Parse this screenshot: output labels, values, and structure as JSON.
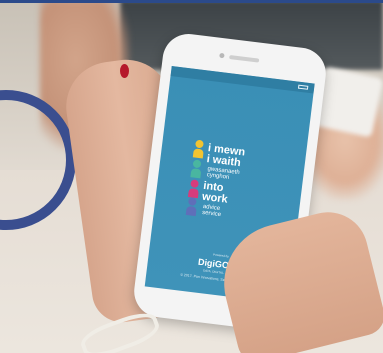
{
  "app_screen": {
    "logo_line1": "i mewn",
    "logo_line2": "i waith",
    "logo_line3": "gwasanaeth",
    "logo_line4": "cynghori",
    "logo_line5": "into",
    "logo_line6": "work",
    "logo_line7": "advice",
    "logo_line8": "service",
    "powered_by": "Powered by",
    "brand": "DigiGOV",
    "brand_tagline": "DATA. DIGITAL. DESIGN",
    "copyright": "© 2017. Pan Innovations. Services Limited"
  },
  "colors": {
    "screen_blue": "#3a8fb6",
    "arc_navy": "#3a4e8f",
    "fig_yellow": "#f2c431",
    "fig_green": "#49b6a0",
    "fig_pink": "#d63b7c",
    "fig_blue": "#5f6fb9",
    "nail_red": "#b5182b"
  }
}
